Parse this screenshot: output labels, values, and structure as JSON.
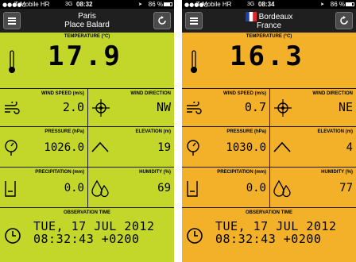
{
  "screens": [
    {
      "theme": {
        "background": "#c2d72a"
      },
      "status": {
        "carrier": "T-Mobile HR",
        "network": "3G",
        "time": "08:32",
        "battery": "86 %"
      },
      "nav": {
        "title_line1": "Paris",
        "title_line2": "Place Balard",
        "flag": ""
      },
      "temperature": {
        "label": "TEMPERATURE (°C)",
        "value": "17.9"
      },
      "wind_speed": {
        "label": "WIND SPEED (m/s)",
        "value": "2.0"
      },
      "wind_direction": {
        "label": "WIND DIRECTION",
        "value": "NW"
      },
      "pressure": {
        "label": "PRESSURE (hPa)",
        "value": "1026.0"
      },
      "elevation": {
        "label": "ELEVATION (m)",
        "value": "19"
      },
      "precipitation": {
        "label": "PRECIPITATION (mm)",
        "value": "0.0"
      },
      "humidity": {
        "label": "HUMIDITY (%)",
        "value": "69"
      },
      "observation": {
        "label": "OBSERVATION TIME",
        "date": "TUE, 17 JUL 2012",
        "time": "08:32:43 +0200"
      }
    },
    {
      "theme": {
        "background": "#f3b12a"
      },
      "status": {
        "carrier": "T-Mobile HR",
        "network": "3G",
        "time": "08:34",
        "battery": "86 %"
      },
      "nav": {
        "title_line1": "Bordeaux",
        "title_line2": "France",
        "flag": "france"
      },
      "temperature": {
        "label": "TEMPERATURE (°C)",
        "value": "16.3"
      },
      "wind_speed": {
        "label": "WIND SPEED (m/s)",
        "value": "0.7"
      },
      "wind_direction": {
        "label": "WIND DIRECTION",
        "value": "NE"
      },
      "pressure": {
        "label": "PRESSURE (hPa)",
        "value": "1030.0"
      },
      "elevation": {
        "label": "ELEVATION (m)",
        "value": "4"
      },
      "precipitation": {
        "label": "PRECIPITATION (mm)",
        "value": "0.0"
      },
      "humidity": {
        "label": "HUMIDITY (%)",
        "value": "77"
      },
      "observation": {
        "label": "OBSERVATION TIME",
        "date": "TUE, 17 JUL 2012",
        "time": "08:32:43 +0200"
      }
    }
  ]
}
